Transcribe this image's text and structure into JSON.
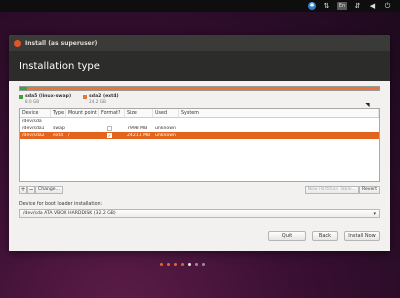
{
  "top_panel": {
    "icons": [
      "bluetooth-icon",
      "transfer-icon",
      "keyboard-layout-icon",
      "network-icon",
      "volume-icon",
      "power-icon"
    ],
    "keyboard_label": "En"
  },
  "window": {
    "title": "Install (as superuser)",
    "header": "Installation type"
  },
  "partition_bar": {
    "segments": [
      {
        "name": "sda5 (linux-swap)",
        "size": "8.0 GB",
        "color": "#3aa33a"
      },
      {
        "name": "sda2 (ext4)",
        "size": "24.2 GB",
        "color": "#e9743a"
      }
    ]
  },
  "table": {
    "columns": [
      "Device",
      "Type",
      "Mount point",
      "Format?",
      "Size",
      "Used",
      "System"
    ],
    "rows": [
      {
        "device": "/dev/sda",
        "type": "",
        "mount": "",
        "format": "",
        "size": "",
        "used": "",
        "system": "",
        "selected": false,
        "checkbox": false
      },
      {
        "device": "/dev/sda1",
        "type": "swap",
        "mount": "",
        "format": "",
        "size": "7998 MB",
        "used": "unknown",
        "system": "",
        "selected": false,
        "checkbox": true,
        "checked": false
      },
      {
        "device": "/dev/sda2",
        "type": "ext4",
        "mount": "/",
        "format": "✓",
        "size": "24211 MB",
        "used": "unknown",
        "system": "",
        "selected": true,
        "checkbox": true,
        "checked": true
      }
    ]
  },
  "toolbar": {
    "add_label": "+",
    "remove_label": "−",
    "change_label": "Change...",
    "new_table_label": "New Partition Table...",
    "revert_label": "Revert"
  },
  "boot_loader": {
    "label": "Device for boot loader installation:",
    "value": "/dev/sda   ATA VBOX HARDDISK (32.2 GB)"
  },
  "buttons": {
    "quit": "Quit",
    "back": "Back",
    "install": "Install Now"
  },
  "progress_dots": {
    "colors": [
      "#e2672e",
      "#e2672e",
      "#e2672e",
      "#e2672e",
      "#e6e6e6",
      "#9a8f96",
      "#9a8f96"
    ]
  }
}
